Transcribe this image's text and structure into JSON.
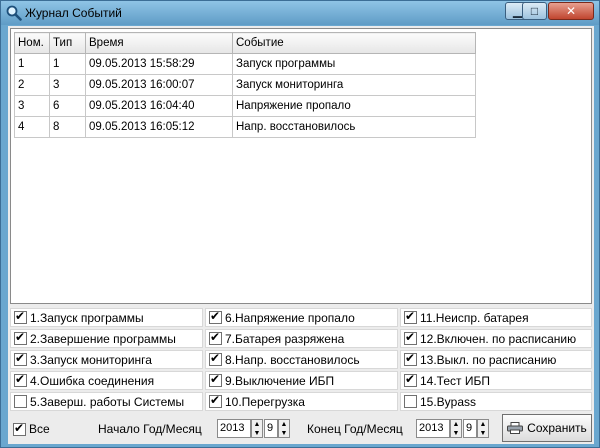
{
  "window": {
    "title": "Журнал Событий",
    "icon": "magnifier-icon",
    "controls": [
      "minimize-icon",
      "maximize-icon",
      "close-icon"
    ]
  },
  "log": {
    "headers": [
      "Ном.",
      "Тип",
      "Время",
      "Событие"
    ],
    "rows": [
      [
        "1",
        "1",
        "09.05.2013 15:58:29",
        "Запуск программы"
      ],
      [
        "2",
        "3",
        "09.05.2013 16:00:07",
        "Запуск мониторинга"
      ],
      [
        "3",
        "6",
        "09.05.2013 16:04:40",
        "Напряжение пропало"
      ],
      [
        "4",
        "8",
        "09.05.2013 16:05:12",
        "Напр. восстановилось"
      ]
    ]
  },
  "filters": [
    {
      "label": "1.Запуск программы",
      "checked": true
    },
    {
      "label": "2.Завершение программы",
      "checked": true
    },
    {
      "label": "3.Запуск мониторинга",
      "checked": true
    },
    {
      "label": "4.Ошибка соединения",
      "checked": true
    },
    {
      "label": "5.Заверш. работы Системы",
      "checked": false
    },
    {
      "label": "6.Напряжение пропало",
      "checked": true
    },
    {
      "label": "7.Батарея разряжена",
      "checked": true
    },
    {
      "label": "8.Напр. восстановилось",
      "checked": true
    },
    {
      "label": "9.Выключение ИБП",
      "checked": true
    },
    {
      "label": "10.Перегрузка",
      "checked": true
    },
    {
      "label": "11.Неиспр. батарея",
      "checked": true
    },
    {
      "label": "12.Включен. по расписанию",
      "checked": true
    },
    {
      "label": "13.Выкл. по расписанию",
      "checked": true
    },
    {
      "label": "14.Тест ИБП",
      "checked": true
    },
    {
      "label": "15.Bypass",
      "checked": false
    }
  ],
  "bottom": {
    "all_label": "Все",
    "all_checked": true,
    "start_label": "Начало Год/Месяц",
    "start_year": "2013",
    "start_month": "9",
    "end_label": "Конец Год/Месяц",
    "end_year": "2013",
    "end_month": "9",
    "save_label": "Сохранить",
    "save_icon": "printer-icon"
  }
}
